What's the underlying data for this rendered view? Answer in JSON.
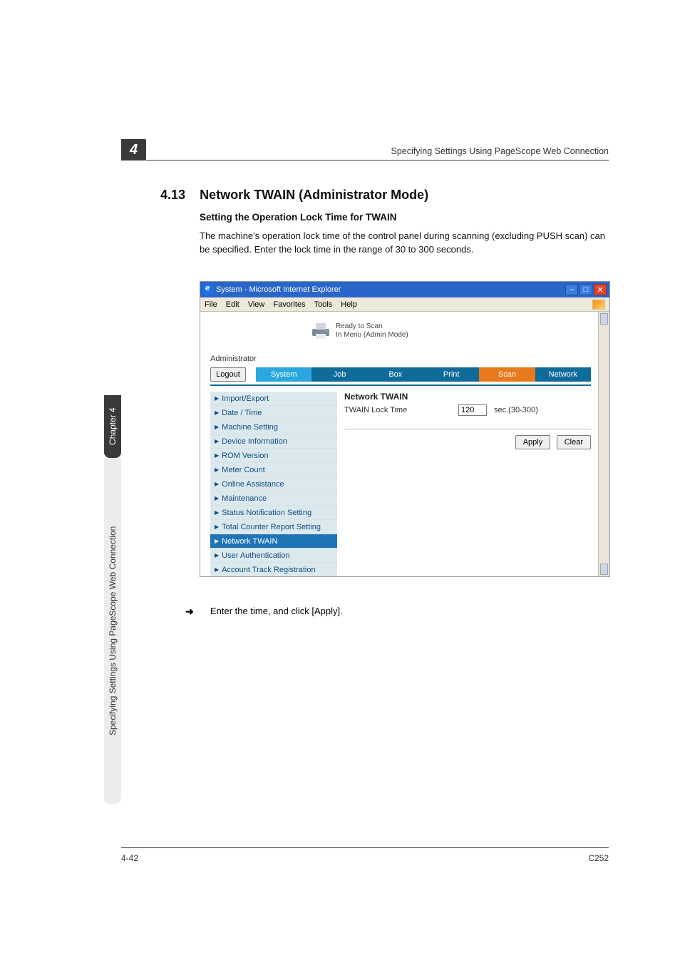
{
  "header": {
    "chapter_number": "4",
    "running_title": "Specifying Settings Using PageScope Web Connection"
  },
  "section": {
    "number": "4.13",
    "title": "Network TWAIN (Administrator Mode)"
  },
  "subsection": {
    "title": "Setting the Operation Lock Time for TWAIN"
  },
  "body": {
    "para1": "The machine's operation lock time of the control panel during scanning (excluding PUSH scan) can be specified. Enter the lock time in the range of 30 to 300 seconds."
  },
  "step": {
    "arrow": "➜",
    "text": "Enter the time, and click [Apply]."
  },
  "sidetabs": {
    "dark": "Chapter 4",
    "light": "Specifying Settings Using PageScope Web Connection"
  },
  "footer": {
    "left": "4-42",
    "right": "C252"
  },
  "screenshot": {
    "window_title": "System - Microsoft Internet Explorer",
    "menus": {
      "file": "File",
      "edit": "Edit",
      "view": "View",
      "favorites": "Favorites",
      "tools": "Tools",
      "help": "Help"
    },
    "win_buttons": {
      "min": "–",
      "max": "□",
      "close": "✕"
    },
    "status": {
      "line1": "Ready to Scan",
      "line2": "In Menu (Admin Mode)"
    },
    "role": "Administrator",
    "logout": "Logout",
    "tabs": {
      "system": "System",
      "job": "Job",
      "box": "Box",
      "print": "Print",
      "scan": "Scan",
      "network": "Network"
    },
    "leftnav": [
      "Import/Export",
      "Date / Time",
      "Machine Setting",
      "Device Information",
      "ROM Version",
      "Meter Count",
      "Online Assistance",
      "Maintenance",
      "Status Notification Setting",
      "Total Counter Report Setting",
      "Network TWAIN",
      "User Authentication",
      "Account Track Registration"
    ],
    "main": {
      "title": "Network TWAIN",
      "row_label": "TWAIN Lock Time",
      "row_value": "120",
      "row_unit": "sec.(30-300)",
      "apply": "Apply",
      "clear": "Clear"
    }
  }
}
